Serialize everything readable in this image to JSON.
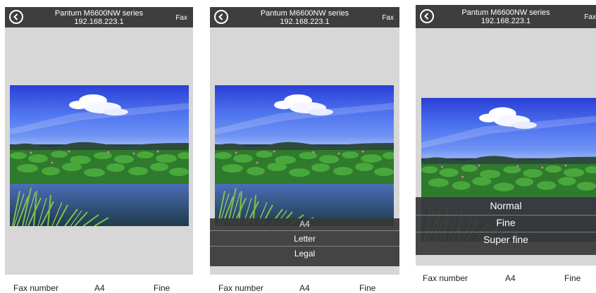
{
  "screens": [
    {
      "header": {
        "title_line1": "Pantum M6600NW series",
        "title_line2": "192.168.223.1",
        "fax_label": "Fax"
      },
      "bottom": {
        "fax_number": "Fax number",
        "paper_size": "A4",
        "resolution": "Fine"
      }
    },
    {
      "header": {
        "title_line1": "Pantum M6600NW series",
        "title_line2": "192.168.223.1",
        "fax_label": "Fax"
      },
      "picker": {
        "options": [
          "A4",
          "Letter",
          "Legal"
        ],
        "selected": "A4"
      },
      "bottom": {
        "fax_number": "Fax number",
        "paper_size": "A4",
        "resolution": "Fine"
      }
    },
    {
      "header": {
        "title_line1": "Pantum M6600NW series",
        "title_line2": "192.168.223.1",
        "fax_label": "Fax"
      },
      "picker": {
        "options": [
          "Normal",
          "Fine",
          "Super fine"
        ],
        "selected": "Fine"
      },
      "bottom": {
        "fax_number": "Fax number",
        "paper_size": "A4",
        "resolution": "Fine"
      }
    }
  ],
  "icons": {
    "back": "back-arrow-icon"
  },
  "colors": {
    "header_bg": "#3e3e3e",
    "screen_bg": "#d7d7d7",
    "picker_bg": "#373737"
  }
}
